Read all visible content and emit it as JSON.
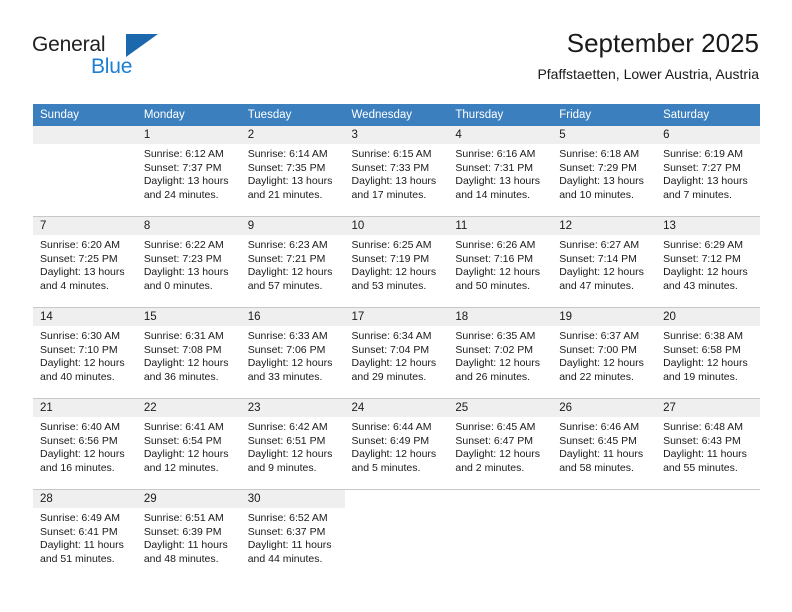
{
  "branding": {
    "name_primary": "General",
    "name_secondary": "Blue",
    "triangle_icon": "triangle-logo-icon",
    "accent_color": "#1b68ad",
    "blue_text_color": "#1c7fd4"
  },
  "header": {
    "title": "September 2025",
    "subtitle": "Pfaffstaetten, Lower Austria, Austria"
  },
  "calendar": {
    "header_bg_color": "#3c7fbe",
    "daynum_band_color": "#efefef",
    "weekday_headers": [
      "Sunday",
      "Monday",
      "Tuesday",
      "Wednesday",
      "Thursday",
      "Friday",
      "Saturday"
    ],
    "weeks": [
      [
        {
          "day": "",
          "sunrise": "",
          "sunset": "",
          "daylight_line1": "",
          "daylight_line2": "",
          "empty": true
        },
        {
          "day": "1",
          "sunrise": "Sunrise: 6:12 AM",
          "sunset": "Sunset: 7:37 PM",
          "daylight_line1": "Daylight: 13 hours",
          "daylight_line2": "and 24 minutes."
        },
        {
          "day": "2",
          "sunrise": "Sunrise: 6:14 AM",
          "sunset": "Sunset: 7:35 PM",
          "daylight_line1": "Daylight: 13 hours",
          "daylight_line2": "and 21 minutes."
        },
        {
          "day": "3",
          "sunrise": "Sunrise: 6:15 AM",
          "sunset": "Sunset: 7:33 PM",
          "daylight_line1": "Daylight: 13 hours",
          "daylight_line2": "and 17 minutes."
        },
        {
          "day": "4",
          "sunrise": "Sunrise: 6:16 AM",
          "sunset": "Sunset: 7:31 PM",
          "daylight_line1": "Daylight: 13 hours",
          "daylight_line2": "and 14 minutes."
        },
        {
          "day": "5",
          "sunrise": "Sunrise: 6:18 AM",
          "sunset": "Sunset: 7:29 PM",
          "daylight_line1": "Daylight: 13 hours",
          "daylight_line2": "and 10 minutes."
        },
        {
          "day": "6",
          "sunrise": "Sunrise: 6:19 AM",
          "sunset": "Sunset: 7:27 PM",
          "daylight_line1": "Daylight: 13 hours",
          "daylight_line2": "and 7 minutes."
        }
      ],
      [
        {
          "day": "7",
          "sunrise": "Sunrise: 6:20 AM",
          "sunset": "Sunset: 7:25 PM",
          "daylight_line1": "Daylight: 13 hours",
          "daylight_line2": "and 4 minutes."
        },
        {
          "day": "8",
          "sunrise": "Sunrise: 6:22 AM",
          "sunset": "Sunset: 7:23 PM",
          "daylight_line1": "Daylight: 13 hours",
          "daylight_line2": "and 0 minutes."
        },
        {
          "day": "9",
          "sunrise": "Sunrise: 6:23 AM",
          "sunset": "Sunset: 7:21 PM",
          "daylight_line1": "Daylight: 12 hours",
          "daylight_line2": "and 57 minutes."
        },
        {
          "day": "10",
          "sunrise": "Sunrise: 6:25 AM",
          "sunset": "Sunset: 7:19 PM",
          "daylight_line1": "Daylight: 12 hours",
          "daylight_line2": "and 53 minutes."
        },
        {
          "day": "11",
          "sunrise": "Sunrise: 6:26 AM",
          "sunset": "Sunset: 7:16 PM",
          "daylight_line1": "Daylight: 12 hours",
          "daylight_line2": "and 50 minutes."
        },
        {
          "day": "12",
          "sunrise": "Sunrise: 6:27 AM",
          "sunset": "Sunset: 7:14 PM",
          "daylight_line1": "Daylight: 12 hours",
          "daylight_line2": "and 47 minutes."
        },
        {
          "day": "13",
          "sunrise": "Sunrise: 6:29 AM",
          "sunset": "Sunset: 7:12 PM",
          "daylight_line1": "Daylight: 12 hours",
          "daylight_line2": "and 43 minutes."
        }
      ],
      [
        {
          "day": "14",
          "sunrise": "Sunrise: 6:30 AM",
          "sunset": "Sunset: 7:10 PM",
          "daylight_line1": "Daylight: 12 hours",
          "daylight_line2": "and 40 minutes."
        },
        {
          "day": "15",
          "sunrise": "Sunrise: 6:31 AM",
          "sunset": "Sunset: 7:08 PM",
          "daylight_line1": "Daylight: 12 hours",
          "daylight_line2": "and 36 minutes."
        },
        {
          "day": "16",
          "sunrise": "Sunrise: 6:33 AM",
          "sunset": "Sunset: 7:06 PM",
          "daylight_line1": "Daylight: 12 hours",
          "daylight_line2": "and 33 minutes."
        },
        {
          "day": "17",
          "sunrise": "Sunrise: 6:34 AM",
          "sunset": "Sunset: 7:04 PM",
          "daylight_line1": "Daylight: 12 hours",
          "daylight_line2": "and 29 minutes."
        },
        {
          "day": "18",
          "sunrise": "Sunrise: 6:35 AM",
          "sunset": "Sunset: 7:02 PM",
          "daylight_line1": "Daylight: 12 hours",
          "daylight_line2": "and 26 minutes."
        },
        {
          "day": "19",
          "sunrise": "Sunrise: 6:37 AM",
          "sunset": "Sunset: 7:00 PM",
          "daylight_line1": "Daylight: 12 hours",
          "daylight_line2": "and 22 minutes."
        },
        {
          "day": "20",
          "sunrise": "Sunrise: 6:38 AM",
          "sunset": "Sunset: 6:58 PM",
          "daylight_line1": "Daylight: 12 hours",
          "daylight_line2": "and 19 minutes."
        }
      ],
      [
        {
          "day": "21",
          "sunrise": "Sunrise: 6:40 AM",
          "sunset": "Sunset: 6:56 PM",
          "daylight_line1": "Daylight: 12 hours",
          "daylight_line2": "and 16 minutes."
        },
        {
          "day": "22",
          "sunrise": "Sunrise: 6:41 AM",
          "sunset": "Sunset: 6:54 PM",
          "daylight_line1": "Daylight: 12 hours",
          "daylight_line2": "and 12 minutes."
        },
        {
          "day": "23",
          "sunrise": "Sunrise: 6:42 AM",
          "sunset": "Sunset: 6:51 PM",
          "daylight_line1": "Daylight: 12 hours",
          "daylight_line2": "and 9 minutes."
        },
        {
          "day": "24",
          "sunrise": "Sunrise: 6:44 AM",
          "sunset": "Sunset: 6:49 PM",
          "daylight_line1": "Daylight: 12 hours",
          "daylight_line2": "and 5 minutes."
        },
        {
          "day": "25",
          "sunrise": "Sunrise: 6:45 AM",
          "sunset": "Sunset: 6:47 PM",
          "daylight_line1": "Daylight: 12 hours",
          "daylight_line2": "and 2 minutes."
        },
        {
          "day": "26",
          "sunrise": "Sunrise: 6:46 AM",
          "sunset": "Sunset: 6:45 PM",
          "daylight_line1": "Daylight: 11 hours",
          "daylight_line2": "and 58 minutes."
        },
        {
          "day": "27",
          "sunrise": "Sunrise: 6:48 AM",
          "sunset": "Sunset: 6:43 PM",
          "daylight_line1": "Daylight: 11 hours",
          "daylight_line2": "and 55 minutes."
        }
      ],
      [
        {
          "day": "28",
          "sunrise": "Sunrise: 6:49 AM",
          "sunset": "Sunset: 6:41 PM",
          "daylight_line1": "Daylight: 11 hours",
          "daylight_line2": "and 51 minutes."
        },
        {
          "day": "29",
          "sunrise": "Sunrise: 6:51 AM",
          "sunset": "Sunset: 6:39 PM",
          "daylight_line1": "Daylight: 11 hours",
          "daylight_line2": "and 48 minutes."
        },
        {
          "day": "30",
          "sunrise": "Sunrise: 6:52 AM",
          "sunset": "Sunset: 6:37 PM",
          "daylight_line1": "Daylight: 11 hours",
          "daylight_line2": "and 44 minutes."
        },
        {
          "day": "",
          "sunrise": "",
          "sunset": "",
          "daylight_line1": "",
          "daylight_line2": "",
          "empty": true,
          "blank": true
        },
        {
          "day": "",
          "sunrise": "",
          "sunset": "",
          "daylight_line1": "",
          "daylight_line2": "",
          "empty": true,
          "blank": true
        },
        {
          "day": "",
          "sunrise": "",
          "sunset": "",
          "daylight_line1": "",
          "daylight_line2": "",
          "empty": true,
          "blank": true
        },
        {
          "day": "",
          "sunrise": "",
          "sunset": "",
          "daylight_line1": "",
          "daylight_line2": "",
          "empty": true,
          "blank": true
        }
      ]
    ]
  }
}
